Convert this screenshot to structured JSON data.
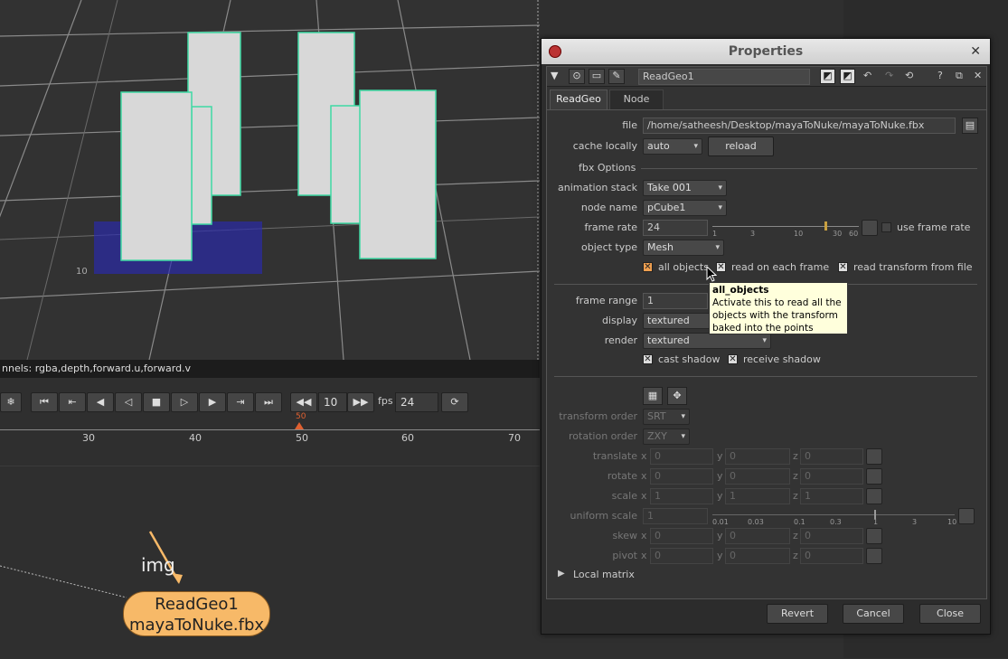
{
  "viewer": {
    "channels_label": "nnels: rgba,depth,forward.u,forward.v",
    "grid_label": "10"
  },
  "transport": {
    "frame": "10",
    "fps_label": "fps",
    "fps_value": "24",
    "playhead_label": "50",
    "ruler": [
      "30",
      "40",
      "50",
      "60",
      "70"
    ]
  },
  "nodegraph": {
    "input_label": "img",
    "node_name": "ReadGeo1",
    "node_file": "mayaToNuke.fbx"
  },
  "panel": {
    "title": "Properties",
    "node_name": "ReadGeo1",
    "tabs": [
      "ReadGeo",
      "Node"
    ],
    "file_label": "file",
    "file_value": "/home/satheesh/Desktop/mayaToNuke/mayaToNuke.fbx",
    "cache_label": "cache locally",
    "cache_value": "auto",
    "reload_label": "reload",
    "fbx_options_label": "fbx Options",
    "anim_stack_label": "animation stack",
    "anim_stack_value": "Take 001",
    "node_name_label": "node name",
    "node_name_value": "pCube1",
    "frame_rate_label": "frame rate",
    "frame_rate_value": "24",
    "frame_rate_ticks": [
      "1",
      "3",
      "10",
      "30",
      "60"
    ],
    "use_frame_rate_label": "use frame rate",
    "object_type_label": "object type",
    "object_type_value": "Mesh",
    "all_objects_label": "all objects",
    "read_each_frame_label": "read on each frame",
    "read_transform_label": "read transform from file",
    "frame_range_label": "frame range",
    "frame_range_value": "1",
    "display_label": "display",
    "display_value": "textured",
    "render_label": "render",
    "render_value": "textured",
    "cast_shadow_label": "cast shadow",
    "receive_shadow_label": "receive shadow",
    "transform_order_label": "transform order",
    "transform_order_value": "SRT",
    "rotation_order_label": "rotation order",
    "rotation_order_value": "ZXY",
    "translate_label": "translate",
    "rotate_label": "rotate",
    "scale_label": "scale",
    "uniform_scale_label": "uniform scale",
    "skew_label": "skew",
    "pivot_label": "pivot",
    "axis_x": "x",
    "axis_y": "y",
    "axis_z": "z",
    "zero": "0",
    "one": "1",
    "uniform_ticks": [
      "0.01",
      "0.03",
      "0.1",
      "0.3",
      "1",
      "3",
      "10"
    ],
    "local_matrix_label": "Local matrix",
    "revert_label": "Revert",
    "cancel_label": "Cancel",
    "close_label": "Close"
  },
  "tooltip": {
    "title": "all_objects",
    "text": "Activate this to read all the objects with the transform baked into the points"
  },
  "colors": {
    "node_fill": "#f7b968",
    "highlight": "#3fd9a4",
    "grid": "#2a2ab0",
    "playhead": "#e06030"
  }
}
